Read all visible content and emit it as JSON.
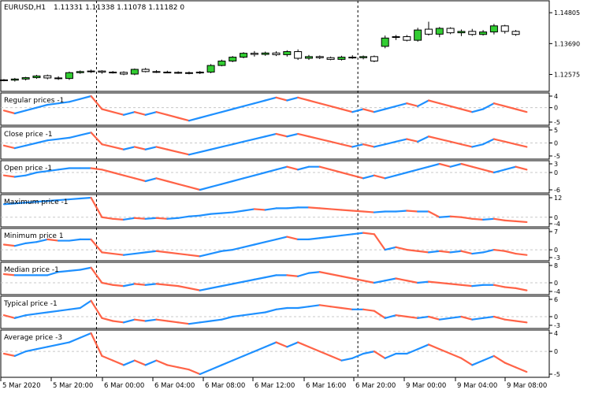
{
  "header": {
    "symbol": "EURUSD,H1",
    "ohlc_values": "1.11331 1.11338 1.11078 1.11182 0"
  },
  "colors": {
    "up_candle": "#32cd32",
    "down_candle": "#ffffff",
    "candle_outline": "#000000",
    "indicator_up": "#1e90ff",
    "indicator_down": "#ff6347",
    "grid": "#c8c8c8",
    "separator": "#000000"
  },
  "price_axis": {
    "ticks": [
      "1.14805",
      "1.13690",
      "1.12575"
    ]
  },
  "panels": [
    {
      "label": "Regular prices -1",
      "ticks": [
        "4",
        "0",
        "-5"
      ]
    },
    {
      "label": "Close price -1",
      "ticks": [
        "5",
        "0",
        "-5"
      ]
    },
    {
      "label": "Open price -1",
      "ticks": [
        "3",
        "0",
        "-6"
      ]
    },
    {
      "label": "Maximum price -1",
      "ticks": [
        "12",
        "0",
        "-4"
      ]
    },
    {
      "label": "Minimum price 1",
      "ticks": [
        "7",
        "0",
        "-3"
      ]
    },
    {
      "label": "Median price -1",
      "ticks": [
        "8",
        "0",
        "-4"
      ]
    },
    {
      "label": "Typical price -1",
      "ticks": [
        "6",
        "0",
        "-3"
      ]
    },
    {
      "label": "Average price -3",
      "ticks": [
        "4",
        "0",
        "-5"
      ]
    }
  ],
  "time_axis": {
    "labels": [
      "5 Mar 2020",
      "5 Mar 20:00",
      "6 Mar 00:00",
      "6 Mar 04:00",
      "6 Mar 08:00",
      "6 Mar 12:00",
      "6 Mar 16:00",
      "6 Mar 20:00",
      "9 Mar 00:00",
      "9 Mar 04:00",
      "9 Mar 08:00"
    ]
  },
  "chart_data": {
    "type": "candlestick",
    "symbol": "EURUSD",
    "timeframe": "H1",
    "price_range": [
      1.1205,
      1.1515
    ],
    "day_separators_after_bar": [
      8,
      32
    ],
    "candles": [
      {
        "o": 1.1238,
        "h": 1.1241,
        "l": 1.1233,
        "c": 1.1237
      },
      {
        "o": 1.1237,
        "h": 1.1245,
        "l": 1.1232,
        "c": 1.1241
      },
      {
        "o": 1.1241,
        "h": 1.1249,
        "l": 1.1236,
        "c": 1.1246
      },
      {
        "o": 1.1246,
        "h": 1.1256,
        "l": 1.1242,
        "c": 1.1252
      },
      {
        "o": 1.1253,
        "h": 1.1257,
        "l": 1.124,
        "c": 1.1245
      },
      {
        "o": 1.1245,
        "h": 1.1251,
        "l": 1.1238,
        "c": 1.1243
      },
      {
        "o": 1.1243,
        "h": 1.1268,
        "l": 1.1238,
        "c": 1.1264
      },
      {
        "o": 1.1264,
        "h": 1.1272,
        "l": 1.126,
        "c": 1.1268
      },
      {
        "o": 1.1268,
        "h": 1.1275,
        "l": 1.1263,
        "c": 1.127
      },
      {
        "o": 1.127,
        "h": 1.1273,
        "l": 1.126,
        "c": 1.1266
      },
      {
        "o": 1.1266,
        "h": 1.127,
        "l": 1.1261,
        "c": 1.1265
      },
      {
        "o": 1.1265,
        "h": 1.1269,
        "l": 1.1255,
        "c": 1.1259
      },
      {
        "o": 1.1259,
        "h": 1.1279,
        "l": 1.1255,
        "c": 1.1276
      },
      {
        "o": 1.1276,
        "h": 1.1281,
        "l": 1.1265,
        "c": 1.1268
      },
      {
        "o": 1.1268,
        "h": 1.1273,
        "l": 1.1263,
        "c": 1.1266
      },
      {
        "o": 1.1266,
        "h": 1.1271,
        "l": 1.1262,
        "c": 1.1265
      },
      {
        "o": 1.1265,
        "h": 1.1269,
        "l": 1.126,
        "c": 1.1264
      },
      {
        "o": 1.1264,
        "h": 1.1268,
        "l": 1.1258,
        "c": 1.1263
      },
      {
        "o": 1.1263,
        "h": 1.127,
        "l": 1.1259,
        "c": 1.1266
      },
      {
        "o": 1.1266,
        "h": 1.1295,
        "l": 1.1262,
        "c": 1.129
      },
      {
        "o": 1.129,
        "h": 1.1311,
        "l": 1.1287,
        "c": 1.1306
      },
      {
        "o": 1.1306,
        "h": 1.1324,
        "l": 1.1302,
        "c": 1.132
      },
      {
        "o": 1.132,
        "h": 1.1338,
        "l": 1.1316,
        "c": 1.1334
      },
      {
        "o": 1.1334,
        "h": 1.1342,
        "l": 1.1322,
        "c": 1.133
      },
      {
        "o": 1.133,
        "h": 1.134,
        "l": 1.1325,
        "c": 1.1335
      },
      {
        "o": 1.1335,
        "h": 1.1341,
        "l": 1.1324,
        "c": 1.1329
      },
      {
        "o": 1.1329,
        "h": 1.1345,
        "l": 1.1322,
        "c": 1.134
      },
      {
        "o": 1.134,
        "h": 1.1348,
        "l": 1.131,
        "c": 1.1316
      },
      {
        "o": 1.1316,
        "h": 1.1328,
        "l": 1.131,
        "c": 1.1322
      },
      {
        "o": 1.1322,
        "h": 1.1326,
        "l": 1.1313,
        "c": 1.1318
      },
      {
        "o": 1.1318,
        "h": 1.1322,
        "l": 1.1309,
        "c": 1.1312
      },
      {
        "o": 1.1312,
        "h": 1.1325,
        "l": 1.1308,
        "c": 1.132
      },
      {
        "o": 1.132,
        "h": 1.1327,
        "l": 1.1314,
        "c": 1.1318
      },
      {
        "o": 1.1318,
        "h": 1.1326,
        "l": 1.1312,
        "c": 1.1322
      },
      {
        "o": 1.1322,
        "h": 1.1326,
        "l": 1.1302,
        "c": 1.1306
      },
      {
        "o": 1.1359,
        "h": 1.1398,
        "l": 1.1352,
        "c": 1.1389
      },
      {
        "o": 1.1392,
        "h": 1.14,
        "l": 1.1382,
        "c": 1.1394
      },
      {
        "o": 1.1394,
        "h": 1.14,
        "l": 1.1377,
        "c": 1.1381
      },
      {
        "o": 1.1381,
        "h": 1.1426,
        "l": 1.1376,
        "c": 1.1418
      },
      {
        "o": 1.1421,
        "h": 1.1448,
        "l": 1.1398,
        "c": 1.1403
      },
      {
        "o": 1.1403,
        "h": 1.1429,
        "l": 1.1392,
        "c": 1.1424
      },
      {
        "o": 1.1424,
        "h": 1.1428,
        "l": 1.1403,
        "c": 1.1408
      },
      {
        "o": 1.1408,
        "h": 1.142,
        "l": 1.1396,
        "c": 1.1413
      },
      {
        "o": 1.1413,
        "h": 1.1422,
        "l": 1.1397,
        "c": 1.1402
      },
      {
        "o": 1.1402,
        "h": 1.1418,
        "l": 1.1398,
        "c": 1.1411
      },
      {
        "o": 1.1411,
        "h": 1.144,
        "l": 1.1402,
        "c": 1.1433
      },
      {
        "o": 1.1433,
        "h": 1.1437,
        "l": 1.1405,
        "c": 1.1413
      },
      {
        "o": 1.1413,
        "h": 1.1418,
        "l": 1.1397,
        "c": 1.1402
      }
    ],
    "indicators": [
      {
        "name": "Regular prices -1",
        "yrange": [
          -5,
          4
        ],
        "values": [
          -1,
          -2,
          -1,
          0,
          1,
          1.5,
          2,
          3,
          4,
          -0.5,
          -1.5,
          -2.5,
          -1.5,
          -2.5,
          -1.5,
          -2.5,
          -3.5,
          -4.5,
          -3.5,
          -2.5,
          -1.5,
          -0.5,
          0.5,
          1.5,
          2.5,
          3.5,
          2.5,
          3.5,
          2.5,
          1.5,
          0.5,
          -0.5,
          -1.5,
          -0.5,
          -1.5,
          -0.5,
          0.5,
          1.5,
          0.5,
          2.5,
          1.5,
          0.5,
          -0.5,
          -1.5,
          -0.5,
          1.5,
          0.5,
          -0.5,
          -1.5
        ]
      },
      {
        "name": "Close price -1",
        "yrange": [
          -5,
          5
        ],
        "values": [
          -1,
          -2,
          -1,
          0,
          1,
          1.5,
          2,
          3,
          4,
          -0.5,
          -1.5,
          -2.5,
          -1.5,
          -2.5,
          -1.5,
          -2.5,
          -3.5,
          -4.5,
          -3.5,
          -2.5,
          -1.5,
          -0.5,
          0.5,
          1.5,
          2.5,
          3.5,
          2.5,
          3.5,
          2.5,
          1.5,
          0.5,
          -0.5,
          -1.5,
          -0.5,
          -1.5,
          -0.5,
          0.5,
          1.5,
          0.5,
          2.5,
          1.5,
          0.5,
          -0.5,
          -1.5,
          -0.5,
          1.5,
          0.5,
          -0.5,
          -1.5
        ]
      },
      {
        "name": "Open price -1",
        "yrange": [
          -6,
          3
        ],
        "values": [
          -1,
          -1.5,
          -1,
          0,
          0.5,
          1,
          1.5,
          1.5,
          1.5,
          1,
          0,
          -1,
          -2,
          -3,
          -2,
          -3,
          -4,
          -5,
          -6,
          -5,
          -4,
          -3,
          -2,
          -1,
          0,
          1,
          2,
          1,
          2,
          2,
          1,
          0,
          -1,
          -2,
          -1,
          -2,
          -1,
          0,
          1,
          2,
          3,
          2,
          3,
          2,
          1,
          0,
          1,
          2,
          1
        ]
      },
      {
        "name": "Maximum price -1",
        "yrange": [
          -4,
          12
        ],
        "values": [
          8,
          8.5,
          9,
          9.5,
          10,
          10.5,
          11,
          11.5,
          12,
          0,
          -1,
          -1.5,
          -0.5,
          -1,
          -0.5,
          -1,
          -0.5,
          0.5,
          1,
          2,
          2.5,
          3,
          4,
          5,
          4.5,
          5.5,
          5.5,
          6,
          6,
          5.5,
          5,
          4.5,
          4,
          3.5,
          3,
          3.5,
          3.5,
          4,
          3.5,
          3.5,
          0,
          0.5,
          0,
          -1,
          -1.5,
          -1,
          -2,
          -2.5,
          -3
        ]
      },
      {
        "name": "Minimum price 1",
        "yrange": [
          -3,
          7
        ],
        "values": [
          2,
          1.5,
          2.5,
          3,
          4,
          3.5,
          3.5,
          4,
          4,
          -1,
          -1.5,
          -2,
          -1.5,
          -1,
          -0.5,
          -1,
          -1.5,
          -2,
          -2.5,
          -1.5,
          -0.5,
          0,
          1,
          2,
          3,
          4,
          5,
          4,
          4,
          4.5,
          5,
          5.5,
          6,
          6.5,
          6,
          0,
          1,
          0,
          -0.5,
          -1,
          -0.5,
          -1,
          -0.5,
          -1.5,
          -1,
          0,
          -0.5,
          -1.5,
          -2
        ]
      },
      {
        "name": "Median price -1",
        "yrange": [
          -4,
          8
        ],
        "values": [
          4,
          3.5,
          3.5,
          3.5,
          3.5,
          5,
          5.5,
          6,
          7,
          0,
          -1,
          -1.5,
          -0.5,
          -1,
          -0.5,
          -1,
          -1.5,
          -2.5,
          -3.5,
          -2.5,
          -1.5,
          -0.5,
          0.5,
          1.5,
          2.5,
          3.5,
          3.5,
          3,
          4.5,
          5,
          4,
          3,
          2,
          1,
          0,
          1,
          2,
          1,
          0,
          0.5,
          0,
          -0.5,
          -1,
          -1.5,
          -1,
          -1,
          -2,
          -2.5,
          -3.5
        ]
      },
      {
        "name": "Typical price -1",
        "yrange": [
          -3,
          6
        ],
        "values": [
          0.5,
          -0.5,
          0.5,
          1,
          1.5,
          2,
          2.5,
          3,
          5.5,
          -0.5,
          -1.5,
          -2,
          -1,
          -1.5,
          -1,
          -1.5,
          -2,
          -2.5,
          -2,
          -1.5,
          -1,
          0,
          0.5,
          1,
          1.5,
          2.5,
          3,
          3,
          3.5,
          4,
          3.5,
          3,
          2.5,
          2.5,
          2,
          -0.5,
          0.5,
          0,
          -0.5,
          0,
          -1,
          -0.5,
          0,
          -1,
          -0.5,
          0,
          -1,
          -1.5,
          -2
        ]
      },
      {
        "name": "Average price -3",
        "yrange": [
          -5,
          4
        ],
        "values": [
          -0.5,
          -1,
          0,
          0.5,
          1,
          1.5,
          2,
          3,
          4,
          -1,
          -2,
          -3,
          -2,
          -3,
          -2,
          -3,
          -3.5,
          -4,
          -5,
          -4,
          -3,
          -2,
          -1,
          0,
          1,
          2,
          1,
          2,
          1,
          0,
          -1,
          -2,
          -1.5,
          -0.5,
          0,
          -1.5,
          -0.5,
          -0.5,
          0.5,
          1.5,
          0.5,
          -0.5,
          -1.5,
          -3,
          -2,
          -1,
          -2.5,
          -3.5,
          -4.5
        ]
      }
    ]
  }
}
